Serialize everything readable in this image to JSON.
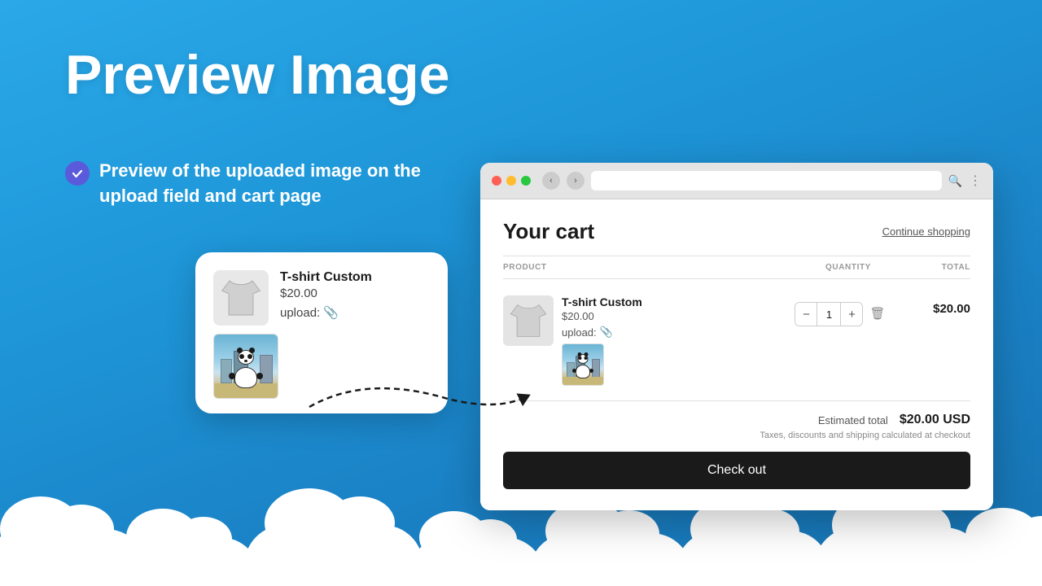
{
  "page": {
    "title": "Preview Image",
    "subtitle": "Preview of the uploaded image on the upload field and cart page"
  },
  "upload_card": {
    "product_name": "T-shirt Custom",
    "product_price": "$20.00",
    "upload_label": "upload:",
    "upload_icon": "📎"
  },
  "browser": {
    "cart_title": "Your cart",
    "continue_shopping": "Continue shopping",
    "columns": {
      "product": "PRODUCT",
      "quantity": "QUANTITY",
      "total": "TOTAL"
    },
    "item": {
      "name": "T-shirt Custom",
      "price": "$20.00",
      "upload_label": "upload:",
      "quantity": "1",
      "total": "$20.00"
    },
    "summary": {
      "estimated_label": "Estimated total",
      "estimated_amount": "$20.00 USD",
      "tax_note": "Taxes, discounts and shipping calculated at checkout",
      "checkout_label": "Check out"
    }
  }
}
